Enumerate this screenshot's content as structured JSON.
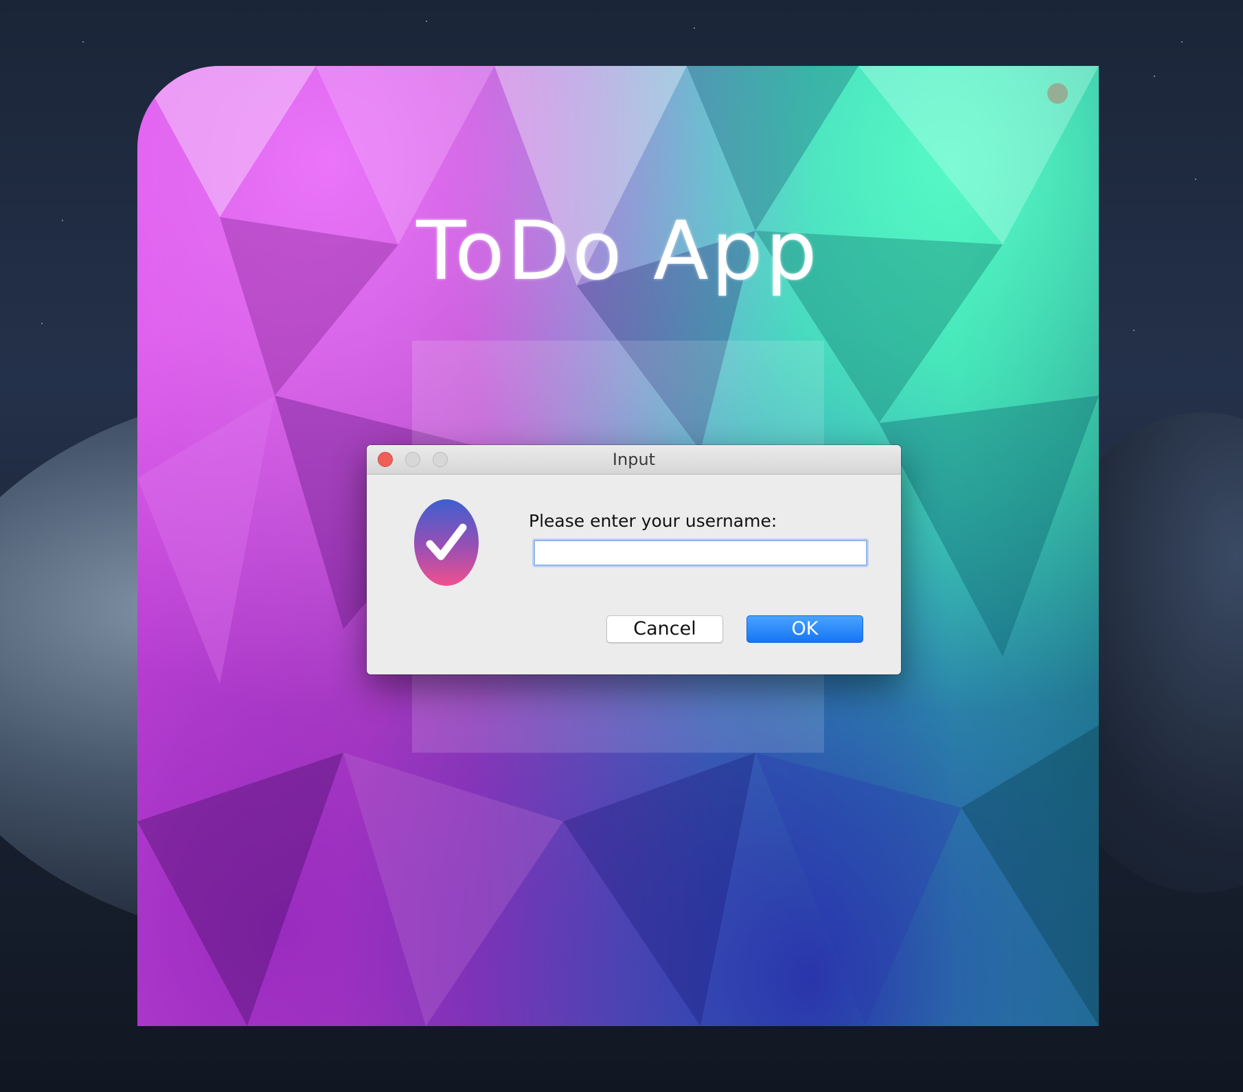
{
  "app": {
    "title": "ToDo App"
  },
  "dialog": {
    "title": "Input",
    "prompt": "Please enter your username:",
    "input_value": "",
    "cancel_label": "Cancel",
    "ok_label": "OK"
  },
  "colors": {
    "ok_button": "#1575f5",
    "close_button": "#ee5f57",
    "dialog_background": "#ececec"
  },
  "icons": {
    "dialog_icon": "checkmark-badge-icon",
    "status": "status-dot-icon"
  }
}
